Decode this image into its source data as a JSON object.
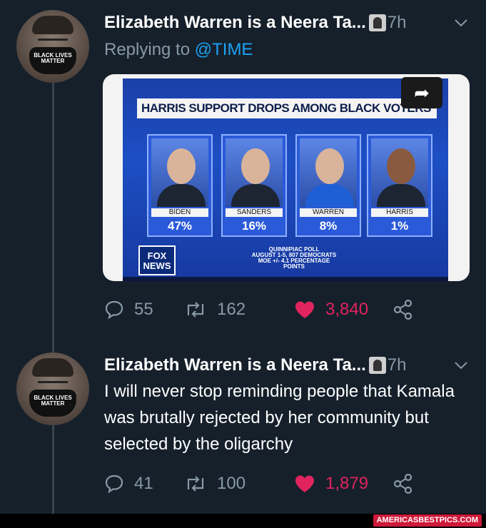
{
  "tweets": [
    {
      "author": "Elizabeth Warren is a Neera Ta...",
      "time": "7h",
      "replying_prefix": "Replying to",
      "replying_handle": "@TIME",
      "mask_text": "BLACK LIVES MATTER",
      "media": {
        "headline": "HARRIS SUPPORT DROPS AMONG BLACK VOTERS",
        "candidates": [
          {
            "name": "BIDEN",
            "pct": "47%"
          },
          {
            "name": "SANDERS",
            "pct": "16%"
          },
          {
            "name": "WARREN",
            "pct": "8%"
          },
          {
            "name": "HARRIS",
            "pct": "1%"
          }
        ],
        "poll_line1": "QUINNIPIAC POLL",
        "poll_line2": "AUGUST 1-5, 807 DEMOCRATS",
        "poll_line3": "MOE +/- 4.1 PERCENTAGE POINTS",
        "network_logo": "FOX NEWS",
        "share_icon": "share-arrow-icon"
      },
      "replies": "55",
      "retweets": "162",
      "likes": "3,840"
    },
    {
      "author": "Elizabeth Warren is a Neera Ta...",
      "time": "7h",
      "mask_text": "BLACK LIVES MATTER",
      "text": "I will never stop reminding people that Kamala was brutally rejected by her community but selected by the oligarchy",
      "replies": "41",
      "retweets": "100",
      "likes": "1,879"
    }
  ],
  "watermark": "AMERICASBESTPICS.COM",
  "colors": {
    "background": "#15202b",
    "muted": "#8899a6",
    "link": "#1da1f2",
    "like": "#e0245e"
  }
}
